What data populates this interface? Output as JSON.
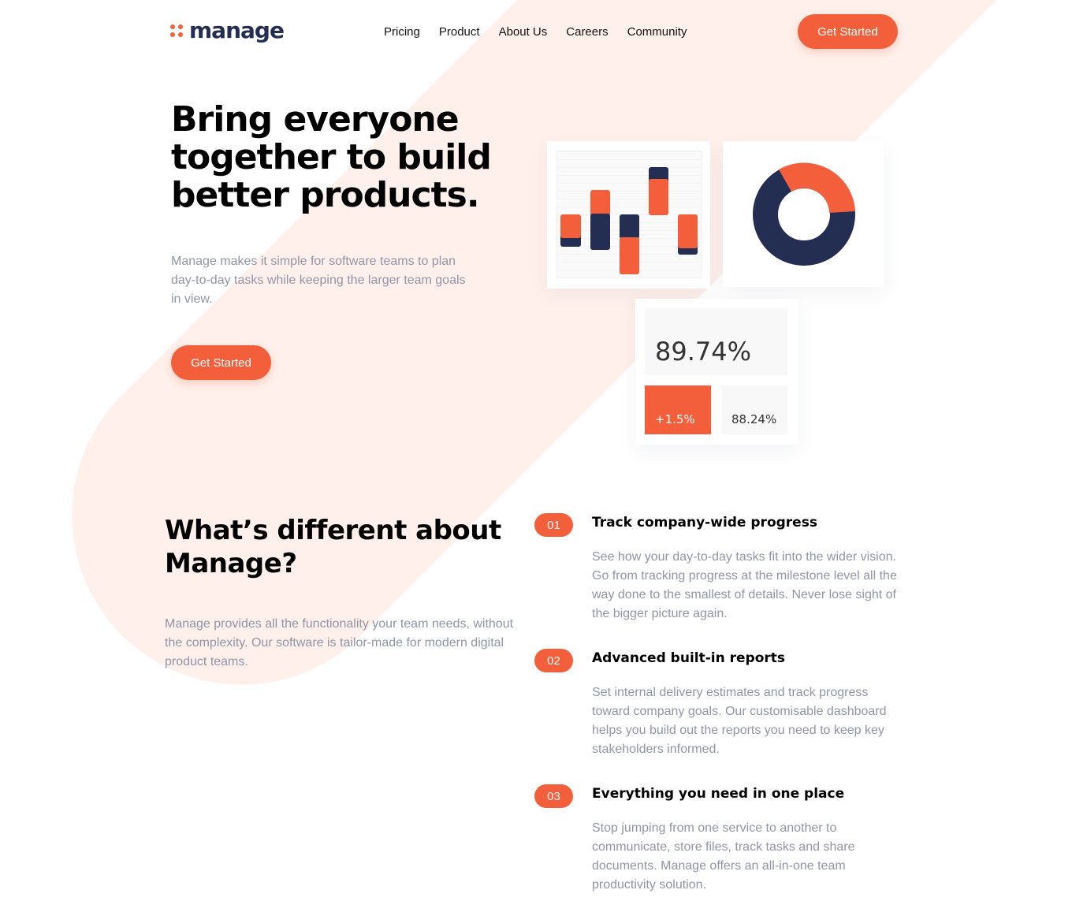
{
  "brand": {
    "name": "manage",
    "accent": "#f25f3a",
    "navy": "#242d52",
    "bg_tint": "#fff0eb"
  },
  "nav": {
    "items": [
      "Pricing",
      "Product",
      "About Us",
      "Careers",
      "Community"
    ],
    "cta": "Get Started"
  },
  "hero": {
    "title": "Bring everyone together to build better products.",
    "text": "Manage makes it simple for software teams to plan day-to-day tasks while keeping the larger team goals in view.",
    "cta": "Get Started"
  },
  "mockup": {
    "big_stat": "89.74%",
    "stat_a": "+1.5%",
    "stat_b": "88.24%"
  },
  "features": {
    "title": "What’s different about Manage?",
    "text": "Manage provides all the functionality your team needs, without the complexity. Our software is tailor-made for modern digital product teams.",
    "items": [
      {
        "num": "01",
        "title": "Track company-wide progress",
        "text": "See how your day-to-day tasks fit into the wider vision. Go from tracking progress at the milestone level all the way done to the smallest of details. Never lose sight of the bigger picture again."
      },
      {
        "num": "02",
        "title": "Advanced built-in reports",
        "text": "Set internal delivery estimates and track progress toward company goals. Our customisable dashboard helps you build out the reports you need to keep key stakeholders informed."
      },
      {
        "num": "03",
        "title": "Everything you need in one place",
        "text": "Stop jumping from one service to another to communicate, store files, track tasks and share documents. Manage offers an all-in-one team productivity solution."
      }
    ]
  }
}
